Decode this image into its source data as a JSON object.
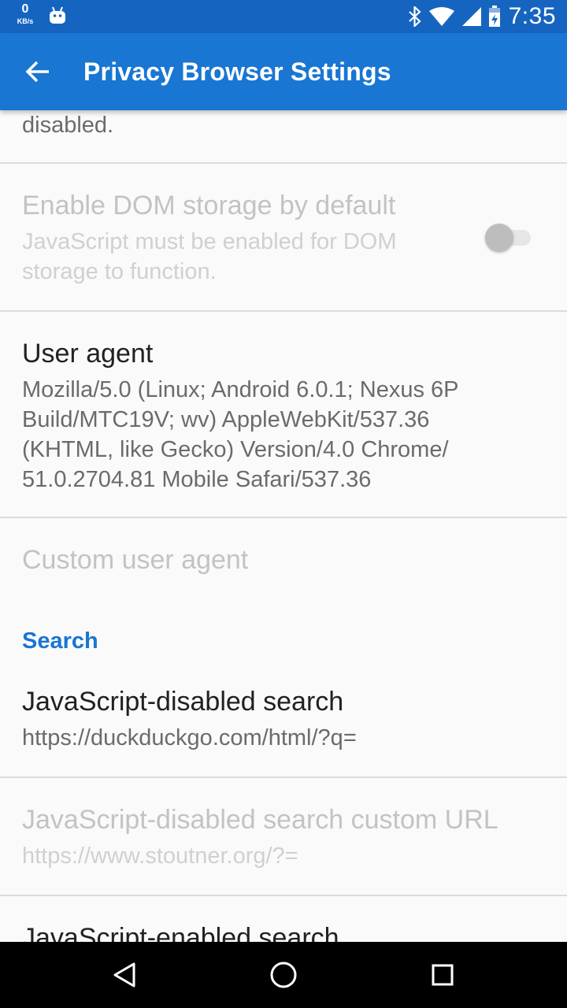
{
  "status_bar": {
    "net_speed_value": "0",
    "net_speed_unit": "KB/s",
    "time": "7:35",
    "icons": [
      "android-icon",
      "bluetooth-icon",
      "wifi-icon",
      "cell-signal-icon",
      "battery-charging-icon"
    ]
  },
  "app_bar": {
    "title": "Privacy Browser Settings",
    "back_icon": "arrow-back-icon",
    "color": "#1976d2"
  },
  "prefs": {
    "top_partial_summary": "disabled.",
    "dom_storage": {
      "title": "Enable DOM storage by default",
      "summary": "JavaScript must be enabled for DOM storage to function.",
      "enabled": false,
      "switch_checked": false
    },
    "user_agent": {
      "title": "User agent",
      "summary": "Mozilla/5.0 (Linux; Android 6.0.1; Nexus 6P Build/MTC19V; wv) AppleWebKit/537.36 (KHTML, like Gecko) Version/4.0 Chrome/ 51.0.2704.81 Mobile Safari/537.36"
    },
    "custom_user_agent": {
      "title": "Custom user agent",
      "enabled": false
    },
    "search_category": "Search",
    "js_disabled_search": {
      "title": "JavaScript-disabled search",
      "summary": "https://duckduckgo.com/html/?q="
    },
    "js_disabled_search_custom": {
      "title": "JavaScript-disabled search custom URL",
      "summary": "https://www.stoutner.org/?=",
      "enabled": false
    },
    "js_enabled_search": {
      "title": "JavaScript-enabled search"
    }
  },
  "nav_bar": {
    "buttons": [
      "back-triangle-icon",
      "home-circle-icon",
      "recents-square-icon"
    ]
  }
}
